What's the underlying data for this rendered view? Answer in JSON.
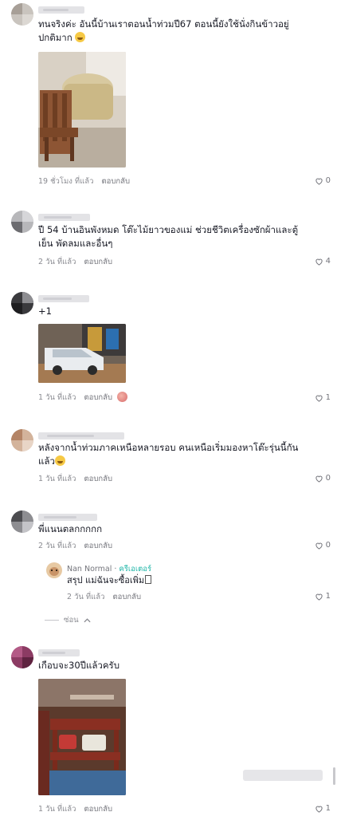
{
  "comments": [
    {
      "text": "ทนจริงค่ะ อันนี้บ้านเราตอนน้ำท่วมปี67 ตอนนี้ยังใช้นั่งกินข้าวอยู่ ปกติมาก",
      "time": "19 ชั่วโมง ที่แล้ว",
      "reply": "ตอบกลับ",
      "likes": "0"
    },
    {
      "text": "ปี 54 บ้านอินพังหมด โต๊ะไม้ยาวของแม่ ช่วยชีวิตเครื่องซักผ้าและตู้เย็น พัดลมและอื่นๆ",
      "time": "2 วัน ที่แล้ว",
      "reply": "ตอบกลับ",
      "likes": "4"
    },
    {
      "text": "+1",
      "time": "1 วัน ที่แล้ว",
      "reply": "ตอบกลับ",
      "likes": "1"
    },
    {
      "text": "หลังจากน้ำท่วมภาคเหนือหลายรอบ คนเหนือเริ่มมองหาโต๊ะรุ่นนี้กันแล้ว",
      "time": "1 วัน ที่แล้ว",
      "reply": "ตอบกลับ",
      "likes": "0"
    },
    {
      "text": "พี่แนนตลกกกกก",
      "time": "2 วัน ที่แล้ว",
      "reply": "ตอบกลับ",
      "likes": "0"
    },
    {
      "text": "เกือบจะ30ปีแล้วครับ",
      "time": "1 วัน ที่แล้ว",
      "reply": "ตอบกลับ",
      "likes": "1"
    }
  ],
  "nested_reply": {
    "username": "Nan Normal",
    "separator": " · ",
    "badge": "ครีเอเตอร์",
    "text": "สรุป แม่ฉันจะซื้อเพิ่ม",
    "time": "2 วัน ที่แล้ว",
    "reply": "ตอบกลับ",
    "likes": "1"
  },
  "hide_replies": "ซ่อน",
  "colors": {
    "text": "#161823",
    "meta": "#8a8b91",
    "creator_badge": "#20b6a8",
    "placeholder": "#e3e3e6"
  },
  "icons": {
    "like": "heart-outline-icon",
    "collapse": "chevron-up-icon"
  }
}
